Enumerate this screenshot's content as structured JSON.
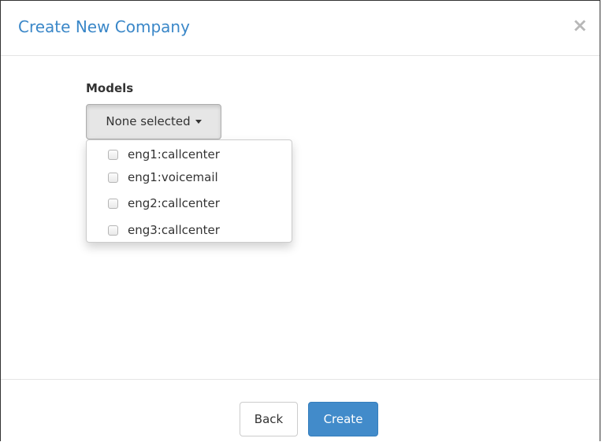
{
  "modal": {
    "title": "Create New Company",
    "close_symbol": "×",
    "close_icon": "close-icon"
  },
  "form": {
    "models_label": "Models",
    "multiselect": {
      "selected_text": "None selected",
      "caret_icon": "caret-down-icon",
      "options": [
        {
          "label": "eng1:callcenter",
          "checked": false
        },
        {
          "label": "eng1:voicemail",
          "checked": false
        },
        {
          "label": "eng2:callcenter",
          "checked": false
        },
        {
          "label": "eng3:callcenter",
          "checked": false
        }
      ]
    }
  },
  "footer": {
    "back_label": "Back",
    "create_label": "Create"
  },
  "colors": {
    "title": "#3a87c8",
    "primary": "#428bca",
    "close": "#b8b8b8"
  }
}
